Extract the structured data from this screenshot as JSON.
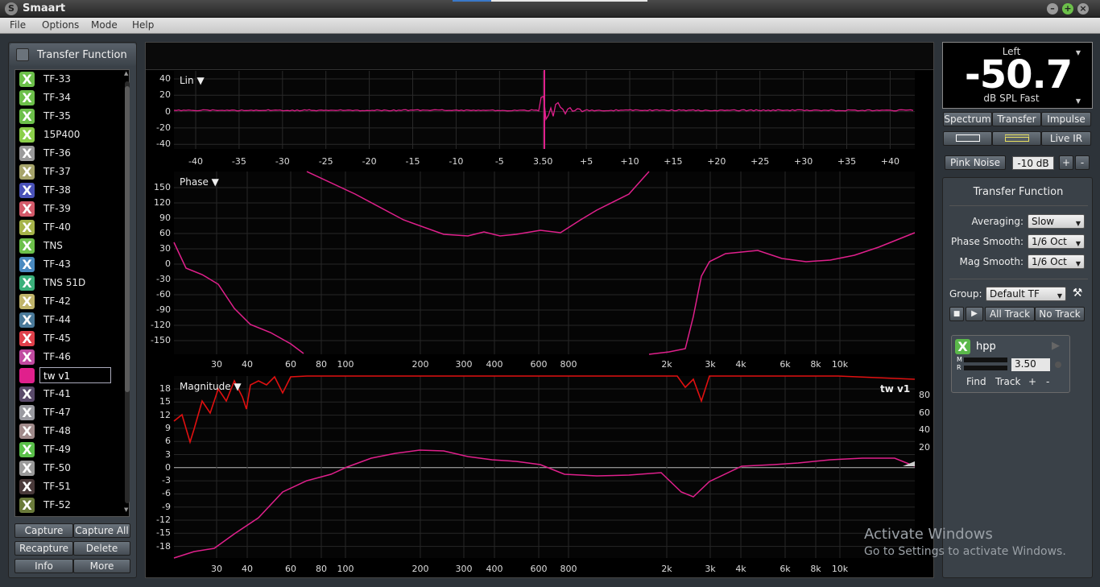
{
  "app": {
    "title": "Smaart"
  },
  "menu": [
    "File",
    "Options",
    "Mode",
    "Help"
  ],
  "left": {
    "title": "Transfer Function",
    "items": [
      {
        "name": "TF-33",
        "color": "#6cc04a"
      },
      {
        "name": "TF-34",
        "color": "#6cc04a"
      },
      {
        "name": "TF-35",
        "color": "#6cc04a"
      },
      {
        "name": "15P400",
        "color": "#8bcf4a"
      },
      {
        "name": "TF-36",
        "color": "#9a9a9a"
      },
      {
        "name": "TF-37",
        "color": "#a6a46a"
      },
      {
        "name": "TF-38",
        "color": "#4a52b8"
      },
      {
        "name": "TF-39",
        "color": "#d45a6a"
      },
      {
        "name": "TF-40",
        "color": "#a6b44a"
      },
      {
        "name": "TNS",
        "color": "#6cc04a"
      },
      {
        "name": "TF-43",
        "color": "#4a8ac0"
      },
      {
        "name": "TNS 51D",
        "color": "#3ab07a"
      },
      {
        "name": "TF-42",
        "color": "#c0b46a"
      },
      {
        "name": "TF-44",
        "color": "#4a7a9a"
      },
      {
        "name": "TF-45",
        "color": "#e0404a"
      },
      {
        "name": "TF-46",
        "color": "#c04aa0"
      },
      {
        "name": "tw v1",
        "color": "#e0208c",
        "editing": true
      },
      {
        "name": "TF-41",
        "color": "#5a4a6a"
      },
      {
        "name": "TF-47",
        "color": "#9a9aa0"
      },
      {
        "name": "TF-48",
        "color": "#a08a8a"
      },
      {
        "name": "TF-49",
        "color": "#5ac04a"
      },
      {
        "name": "TF-50",
        "color": "#9a9a9a"
      },
      {
        "name": "TF-51",
        "color": "#4a3a3a"
      },
      {
        "name": "TF-52",
        "color": "#6a7a3a"
      }
    ],
    "buttons": {
      "capture": "Capture",
      "capture_all": "Capture All",
      "recapture": "Recapture",
      "delete": "Delete",
      "info": "Info",
      "more": "More"
    }
  },
  "meter": {
    "channel": "Left",
    "value": "-50.7",
    "unit": "dB SPL Fast"
  },
  "tabs": {
    "spectrum": "Spectrum",
    "transfer": "Transfer",
    "impulse": "Impulse",
    "live_ir": "Live IR"
  },
  "generator": {
    "label": "Pink Noise",
    "level": "-10 dB",
    "plus": "+",
    "minus": "-"
  },
  "tf_panel": {
    "title": "Transfer Function",
    "averaging_label": "Averaging:",
    "averaging": "Slow",
    "phase_smooth_label": "Phase Smooth:",
    "phase_smooth": "1/6 Oct",
    "mag_smooth_label": "Mag Smooth:",
    "mag_smooth": "1/6 Oct",
    "group_label": "Group:",
    "group": "Default TF",
    "all_track": "All Track",
    "no_track": "No Track"
  },
  "track": {
    "name": "hpp",
    "m": "M",
    "r": "R",
    "delay": "3.50",
    "find": "Find",
    "track": "Track",
    "plus": "+",
    "minus": "-"
  },
  "plots": {
    "impulse": {
      "label": "Lin ▼",
      "y_ticks": [
        "40",
        "20",
        "0",
        "-20",
        "-40"
      ],
      "x_ticks": [
        "-40",
        "-35",
        "-30",
        "-25",
        "-20",
        "-15",
        "-10",
        "-5",
        "3.50",
        "+5",
        "+10",
        "+15",
        "+20",
        "+25",
        "+30",
        "+35",
        "+40"
      ]
    },
    "phase": {
      "label": "Phase ▼",
      "y_ticks": [
        "150",
        "120",
        "90",
        "60",
        "30",
        "0",
        "-30",
        "-60",
        "-90",
        "-120",
        "-150"
      ]
    },
    "magnitude": {
      "label": "Magnitude ▼",
      "trace_label": "tw v1",
      "y_ticks": [
        "18",
        "15",
        "12",
        "9",
        "6",
        "3",
        "0",
        "-3",
        "-6",
        "-9",
        "-12",
        "-15",
        "-18"
      ],
      "y2_ticks": [
        "80",
        "60",
        "40",
        "20"
      ]
    },
    "freq_ticks": [
      "30",
      "40",
      "60",
      "80",
      "100",
      "200",
      "300",
      "400",
      "600",
      "800",
      "2k",
      "3k",
      "4k",
      "6k",
      "8k",
      "10k"
    ]
  },
  "watermark": {
    "line1": "Activate Windows",
    "line2": "Go to Settings to activate Windows."
  },
  "colors": {
    "trace": "#e0208c",
    "coherence": "#e01010",
    "panel": "#3a4148"
  }
}
